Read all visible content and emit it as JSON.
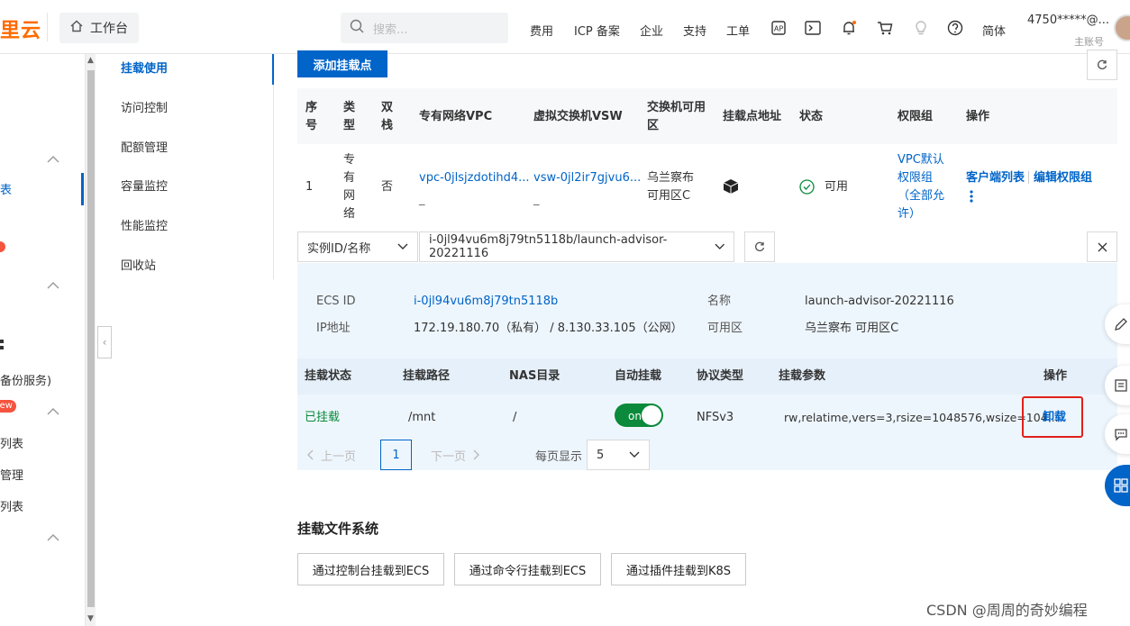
{
  "topbar": {
    "logo": "里云",
    "workbench": "工作台",
    "search_placeholder": "搜索...",
    "nav": [
      "费用",
      "ICP 备案",
      "企业",
      "支持",
      "工单"
    ],
    "lang": "简体",
    "account": "4750*****@...",
    "account_role": "主账号"
  },
  "leftnav": {
    "items": [
      "表",
      "备份服务)",
      "列表",
      "管理",
      "列表"
    ],
    "badge_new": "ew"
  },
  "subnav": {
    "items": [
      "挂载使用",
      "访问控制",
      "配额管理",
      "容量监控",
      "性能监控",
      "回收站"
    ],
    "active_index": 0
  },
  "main": {
    "add_button": "添加挂载点",
    "columns": [
      "序号",
      "类型",
      "双栈",
      "专有网络VPC",
      "虚拟交换机VSW",
      "交换机可用区",
      "挂载点地址",
      "状态",
      "权限组",
      "操作"
    ],
    "row": {
      "index": "1",
      "type": "专有网络",
      "dual_stack": "否",
      "vpc": "vpc-0jlsjzdotihd4...",
      "vsw": "vsw-0jl2ir7gjvu6...",
      "zone": "乌兰察布可用区C",
      "status": "可用",
      "perm_group": "VPC默认权限组（全部允许）",
      "action_clients": "客户端列表",
      "action_edit": "编辑权限组"
    },
    "instance_select": "实例ID/名称",
    "instance_value": "i-0jl94vu6m8j79tn5118b/launch-advisor-20221116",
    "detail": {
      "ecs_id_label": "ECS ID",
      "ecs_id_value": "i-0jl94vu6m8j79tn5118b",
      "name_label": "名称",
      "name_value": "launch-advisor-20221116",
      "ip_label": "IP地址",
      "ip_value": "172.19.180.70（私有） / 8.130.33.105（公网）",
      "zone_label": "可用区",
      "zone_value": "乌兰察布 可用区C"
    },
    "mount_columns": [
      "挂载状态",
      "挂载路径",
      "NAS目录",
      "自动挂载",
      "协议类型",
      "挂载参数",
      "操作"
    ],
    "mount_row": {
      "status": "已挂载",
      "path": "/mnt",
      "nas_dir": "/",
      "auto_mount": "on",
      "protocol": "NFSv3",
      "params": "rw,relatime,vers=3,rsize=1048576,wsize=104...",
      "action": "卸载"
    },
    "pagination": {
      "prev": "上一页",
      "page": "1",
      "next": "下一页",
      "per_page_label": "每页显示",
      "per_page": "5"
    },
    "section_title": "挂载文件系统",
    "mount_buttons": [
      "通过控制台挂载到ECS",
      "通过命令行挂载到ECS",
      "通过插件挂载到K8S"
    ]
  },
  "watermark": "CSDN @周周的奇妙编程",
  "colors": {
    "accent": "#0064c8",
    "brand": "#ff6a00",
    "success": "#0a8a3a",
    "danger": "#e0201b"
  }
}
